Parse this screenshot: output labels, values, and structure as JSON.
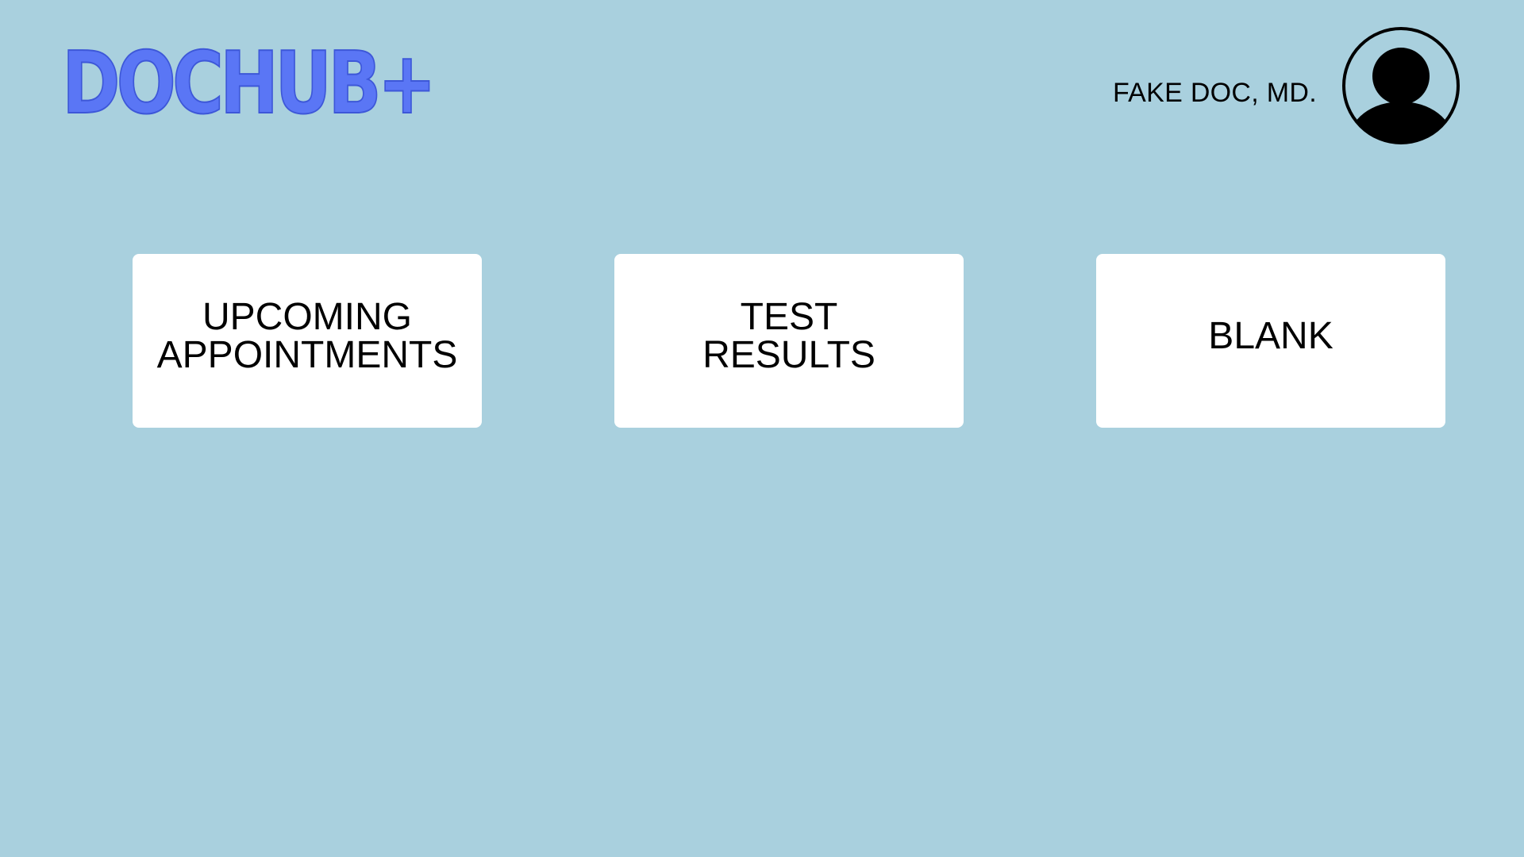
{
  "header": {
    "logo_text": "DOCHUB+",
    "user_name": "FAKE DOC, MD.",
    "avatar_icon": "user-avatar-icon"
  },
  "cards": [
    {
      "label": "UPCOMING\nAPPOINTMENTS"
    },
    {
      "label": "TEST\nRESULTS"
    },
    {
      "label": "BLANK"
    }
  ],
  "colors": {
    "background": "#a9d0de",
    "logo": "#5a76f5",
    "card": "#ffffff",
    "text": "#000000"
  }
}
